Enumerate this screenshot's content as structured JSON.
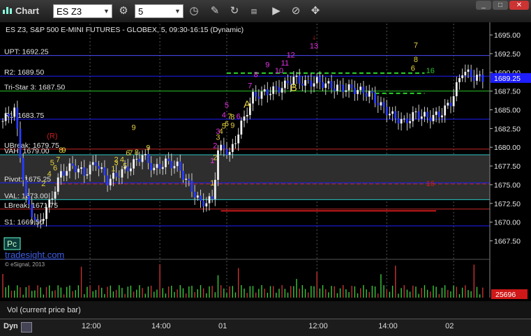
{
  "window": {
    "title": "Chart",
    "symbol": "ES Z3",
    "interval": "5"
  },
  "chart_data": {
    "type": "candlestick",
    "title": "ES Z3, S&P 500 E-MINI FUTURES - GLOBEX, 5, 09:30-16:15 (Dynamic)",
    "ylim": [
      1665.5,
      1696.5
    ],
    "y_ticks": [
      "1695.00",
      "1692.50",
      "1690.00",
      "1687.50",
      "1685.00",
      "1682.50",
      "1680.00",
      "1677.50",
      "1675.00",
      "1672.50",
      "1670.00",
      "1667.50"
    ],
    "x_ticks": [
      {
        "label": "12:00",
        "bar": 30
      },
      {
        "label": "14:00",
        "bar": 54
      },
      {
        "label": "01",
        "bar": 77
      },
      {
        "label": "12:00",
        "bar": 108
      },
      {
        "label": "14:00",
        "bar": 132
      },
      {
        "label": "02",
        "bar": 155
      }
    ],
    "last_price": "1689.25",
    "levels": [
      {
        "label": "UPT: 1692.25",
        "price": 1692.25,
        "color": "#4b4bff",
        "style": "solid"
      },
      {
        "label": "R2: 1689.50",
        "price": 1689.5,
        "color": "#1e1eff",
        "style": "solid"
      },
      {
        "label": "Tri-Star 3: 1687.50",
        "price": 1687.5,
        "color": "#29c429",
        "style": "solid"
      },
      {
        "label": "R1: 1683.75",
        "price": 1683.75,
        "color": "#1e1eff",
        "style": "solid"
      },
      {
        "label": "UBreak: 1679.75",
        "price": 1679.75,
        "color": "#c82828",
        "style": "solid"
      },
      {
        "label": "VAH: 1679.00",
        "price": 1679.0,
        "color": "#29c4c4",
        "style": "solid"
      },
      {
        "label": "Pivot: 1675.25",
        "price": 1675.25,
        "color": "#1e1eff",
        "style": "solid"
      },
      {
        "label": "VAL: 1673.00",
        "price": 1673.0,
        "color": "#29c4c4",
        "style": "solid"
      },
      {
        "label": "LBreak: 1671.75",
        "price": 1671.75,
        "color": "#c82828",
        "style": "solid"
      },
      {
        "label": "S1: 1669.50",
        "price": 1669.5,
        "color": "#1e1eff",
        "style": "solid"
      }
    ],
    "value_area": {
      "from": 1673.0,
      "to": 1679.0
    },
    "countdown_labels": [
      {
        "text": "(R)",
        "bar": 17,
        "price": 1681.2,
        "color": "#c81e1e"
      },
      {
        "text": "9",
        "bar": 45,
        "price": 1682.3,
        "color": "#e6d23c"
      },
      {
        "text": "2",
        "bar": 14,
        "price": 1674.8,
        "color": "#e6d23c"
      },
      {
        "text": "4",
        "bar": 16,
        "price": 1676.1,
        "color": "#e6d23c"
      },
      {
        "text": "5",
        "bar": 17,
        "price": 1677.6,
        "color": "#e6d23c"
      },
      {
        "text": "6",
        "bar": 18,
        "price": 1676.9,
        "color": "#e6d23c"
      },
      {
        "text": "7",
        "bar": 19,
        "price": 1678.0,
        "color": "#e6d23c"
      },
      {
        "text": "8",
        "bar": 20,
        "price": 1679.3,
        "color": "#e6d23c"
      },
      {
        "text": "9",
        "bar": 21,
        "price": 1679.3,
        "color": "#e6d23c"
      },
      {
        "text": "1",
        "bar": 38,
        "price": 1676.8,
        "color": "#e6d23c"
      },
      {
        "text": "2",
        "bar": 39,
        "price": 1678.0,
        "color": "#e6d23c"
      },
      {
        "text": "3",
        "bar": 39,
        "price": 1677.6,
        "color": "#e6d23c"
      },
      {
        "text": "4",
        "bar": 41,
        "price": 1678.0,
        "color": "#e6d23c"
      },
      {
        "text": "5",
        "bar": 42,
        "price": 1677.2,
        "color": "#e6d23c"
      },
      {
        "text": "6",
        "bar": 43,
        "price": 1678.9,
        "color": "#e6d23c"
      },
      {
        "text": "7",
        "bar": 44,
        "price": 1678.9,
        "color": "#e6d23c"
      },
      {
        "text": "8",
        "bar": 46,
        "price": 1679.0,
        "color": "#e6d23c"
      },
      {
        "text": "9",
        "bar": 50,
        "price": 1679.6,
        "color": "#e6d23c"
      },
      {
        "text": "1",
        "bar": 72,
        "price": 1674.9,
        "color": "#e6d23c"
      },
      {
        "text": "2",
        "bar": 73,
        "price": 1678.3,
        "color": "#e6d23c"
      },
      {
        "text": "3",
        "bar": 74,
        "price": 1681.0,
        "color": "#e6d23c"
      },
      {
        "text": "4",
        "bar": 75,
        "price": 1681.8,
        "color": "#e6d23c"
      },
      {
        "text": "5",
        "bar": 76,
        "price": 1682.5,
        "color": "#e6d23c"
      },
      {
        "text": "6",
        "bar": 77,
        "price": 1682.8,
        "color": "#e6d23c"
      },
      {
        "text": "7",
        "bar": 78,
        "price": 1683.8,
        "color": "#e6d23c"
      },
      {
        "text": "8",
        "bar": 79,
        "price": 1683.7,
        "color": "#e6d23c"
      },
      {
        "text": "9",
        "bar": 79,
        "price": 1682.6,
        "color": "#e6d23c"
      },
      {
        "text": "A",
        "bar": 84,
        "price": 1685.3,
        "color": "#e6d23c"
      },
      {
        "text": "B",
        "bar": 100,
        "price": 1687.5,
        "color": "#e6d23c"
      },
      {
        "text": "1",
        "bar": 72,
        "price": 1677.9,
        "color": "#e632e6"
      },
      {
        "text": "2",
        "bar": 73,
        "price": 1679.9,
        "color": "#e632e6"
      },
      {
        "text": "3",
        "bar": 74,
        "price": 1681.8,
        "color": "#e632e6"
      },
      {
        "text": "4",
        "bar": 76,
        "price": 1684.0,
        "color": "#e632e6"
      },
      {
        "text": "5",
        "bar": 77,
        "price": 1685.3,
        "color": "#e632e6"
      },
      {
        "text": "6",
        "bar": 81,
        "price": 1683.8,
        "color": "#e632e6"
      },
      {
        "text": "7",
        "bar": 85,
        "price": 1687.9,
        "color": "#e632e6"
      },
      {
        "text": "8",
        "bar": 87,
        "price": 1689.4,
        "color": "#e632e6"
      },
      {
        "text": "9",
        "bar": 91,
        "price": 1690.7,
        "color": "#e632e6"
      },
      {
        "text": "10",
        "bar": 95,
        "price": 1689.9,
        "color": "#e632e6"
      },
      {
        "text": "11",
        "bar": 97,
        "price": 1690.9,
        "color": "#e632e6"
      },
      {
        "text": "12",
        "bar": 99,
        "price": 1692.0,
        "color": "#e632e6"
      },
      {
        "text": "13",
        "bar": 107,
        "price": 1693.2,
        "color": "#e632e6"
      },
      {
        "text": "7",
        "bar": 142,
        "price": 1693.3,
        "color": "#e6d23c"
      },
      {
        "text": "8",
        "bar": 142,
        "price": 1691.4,
        "color": "#e6d23c"
      },
      {
        "text": "6",
        "bar": 141,
        "price": 1690.2,
        "color": "#e6d23c"
      },
      {
        "text": "16",
        "bar": 147,
        "price": 1689.9,
        "color": "#29c429"
      },
      {
        "text": "16",
        "bar": 147,
        "price": 1674.8,
        "color": "#c81e1e"
      }
    ],
    "legend_note": "Pc",
    "watermarks": [
      "tradesight.com",
      "© eSignal, 2013"
    ]
  },
  "volume_panel": {
    "label": "Vol (current price bar)",
    "last_value": "25696"
  },
  "footer": {
    "mode": "Dyn"
  }
}
